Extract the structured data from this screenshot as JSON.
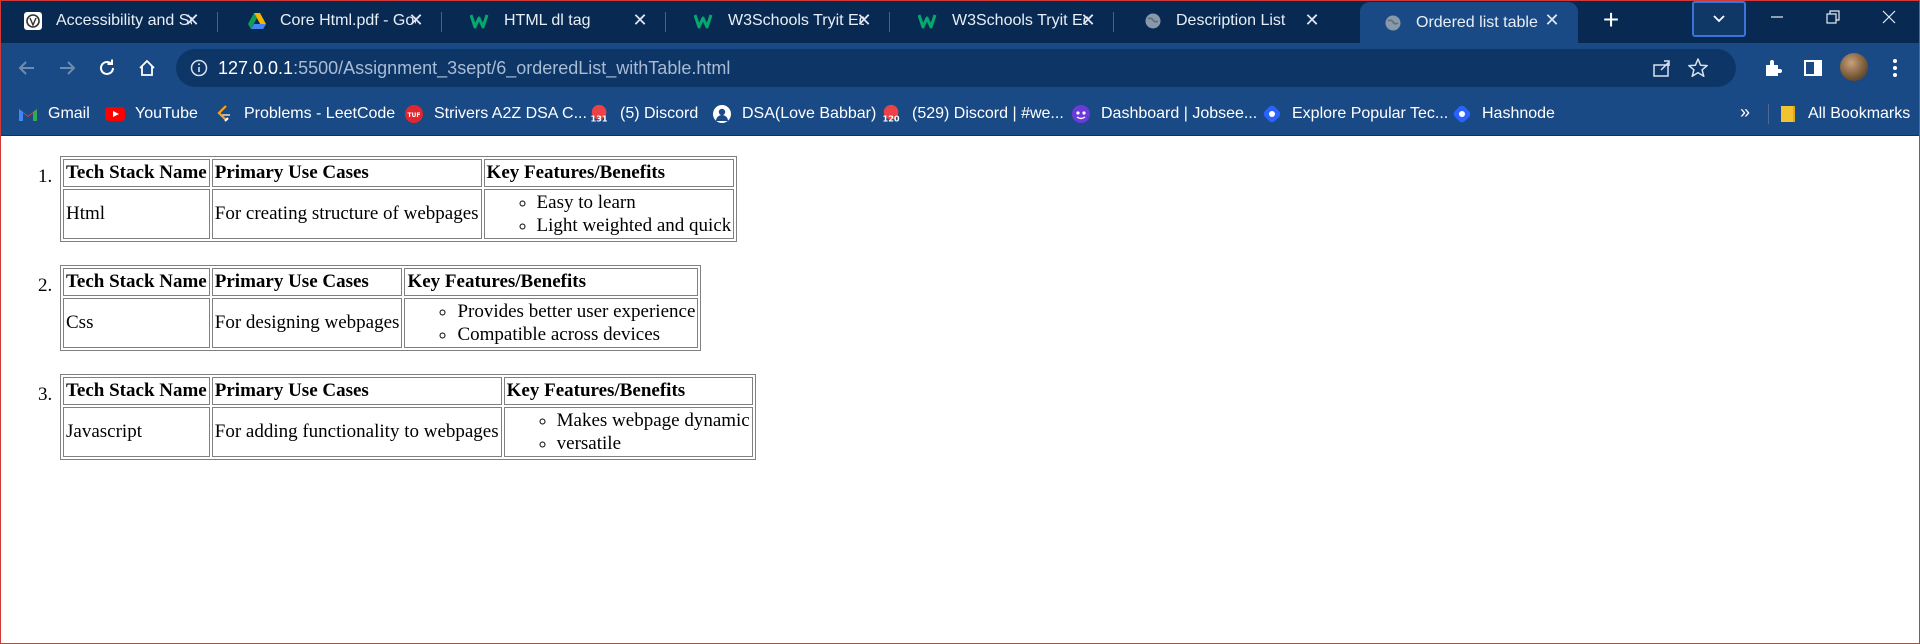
{
  "browser": {
    "tabs": [
      {
        "title": "Accessibility and Sem",
        "icon": "wordpress-icon"
      },
      {
        "title": "Core Html.pdf - Goog",
        "icon": "google-drive-icon"
      },
      {
        "title": "HTML dl tag",
        "icon": "w3schools-icon"
      },
      {
        "title": "W3Schools Tryit Edito",
        "icon": "w3schools-icon"
      },
      {
        "title": "W3Schools Tryit Edito",
        "icon": "w3schools-icon"
      },
      {
        "title": "Description List",
        "icon": "globe-icon"
      },
      {
        "title": "Ordered list table",
        "icon": "globe-icon",
        "active": true
      }
    ],
    "url": {
      "host": "127.0.0.1",
      "rest": ":5500/Assignment_3sept/6_orderedList_withTable.html"
    }
  },
  "bookmarks": {
    "items": [
      {
        "label": "Gmail",
        "icon": "gmail-icon"
      },
      {
        "label": "YouTube",
        "icon": "youtube-icon"
      },
      {
        "label": "Problems - LeetCode",
        "icon": "leetcode-icon"
      },
      {
        "label": "Strivers A2Z DSA C...",
        "icon": "tuf-icon"
      },
      {
        "label": "(5) Discord",
        "icon": "discord-icon",
        "badge": "131"
      },
      {
        "label": "DSA(Love Babbar)",
        "icon": "babbar-icon"
      },
      {
        "label": "(529) Discord | #we...",
        "icon": "discord-icon",
        "badge": "120"
      },
      {
        "label": "Dashboard | Jobsee...",
        "icon": "jobsee-icon"
      },
      {
        "label": "Explore Popular Tec...",
        "icon": "hashnode-icon"
      },
      {
        "label": "Hashnode",
        "icon": "hashnode-icon"
      }
    ],
    "more": "»",
    "all_bookmarks": "All Bookmarks"
  },
  "page": {
    "headers": {
      "name": "Tech Stack Name",
      "use": "Primary Use Cases",
      "features": "Key Features/Benefits"
    },
    "items": [
      {
        "marker": "1.",
        "name": "Html",
        "use": "For creating structure of webpages",
        "features": [
          "Easy to learn",
          "Light weighted and quick"
        ]
      },
      {
        "marker": "2.",
        "name": "Css",
        "use": "For designing webpages",
        "features": [
          "Provides better user experience",
          "Compatible across devices"
        ]
      },
      {
        "marker": "3.",
        "name": "Javascript",
        "use": "For adding functionality to webpages",
        "features": [
          "Makes webpage dynamic",
          "versatile"
        ]
      }
    ]
  }
}
